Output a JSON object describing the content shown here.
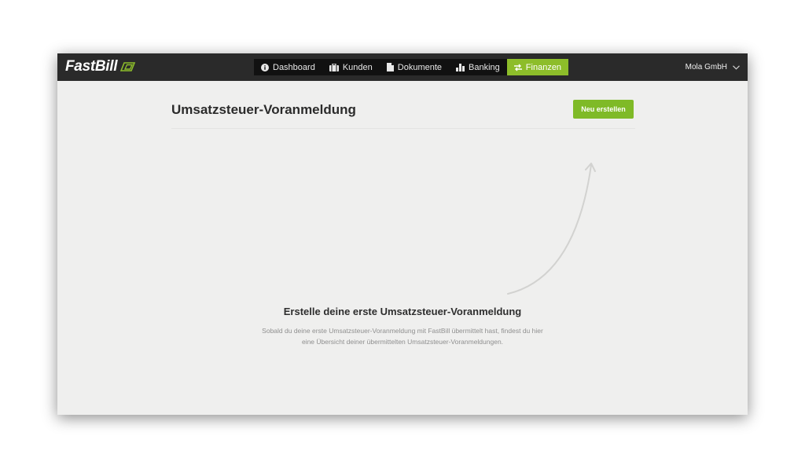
{
  "brand": {
    "name_main": "FastBill"
  },
  "nav": {
    "items": [
      {
        "label": "Dashboard",
        "icon": "info-icon",
        "active": false
      },
      {
        "label": "Kunden",
        "icon": "briefcase-icon",
        "active": false
      },
      {
        "label": "Dokumente",
        "icon": "document-icon",
        "active": false
      },
      {
        "label": "Banking",
        "icon": "bar-chart-icon",
        "active": false
      },
      {
        "label": "Finanzen",
        "icon": "exchange-icon",
        "active": true
      }
    ]
  },
  "account": {
    "name": "Mola GmbH",
    "icon": "chevron-down-icon"
  },
  "page": {
    "title": "Umsatzsteuer-Voranmeldung",
    "new_button_label": "Neu erstellen"
  },
  "empty_state": {
    "title": "Erstelle deine erste Umsatzsteuer-Voranmeldung",
    "line1": "Sobald du deine erste Umsatzsteuer-Voranmeldung mit FastBill übermittelt hast, findest du hier",
    "line2": "eine Übersicht deiner übermittelten Umsatzsteuer-Voranmeldungen."
  },
  "colors": {
    "topbar": "#2a2a2a",
    "accent": "#8dbd2a",
    "background": "#efefee"
  }
}
